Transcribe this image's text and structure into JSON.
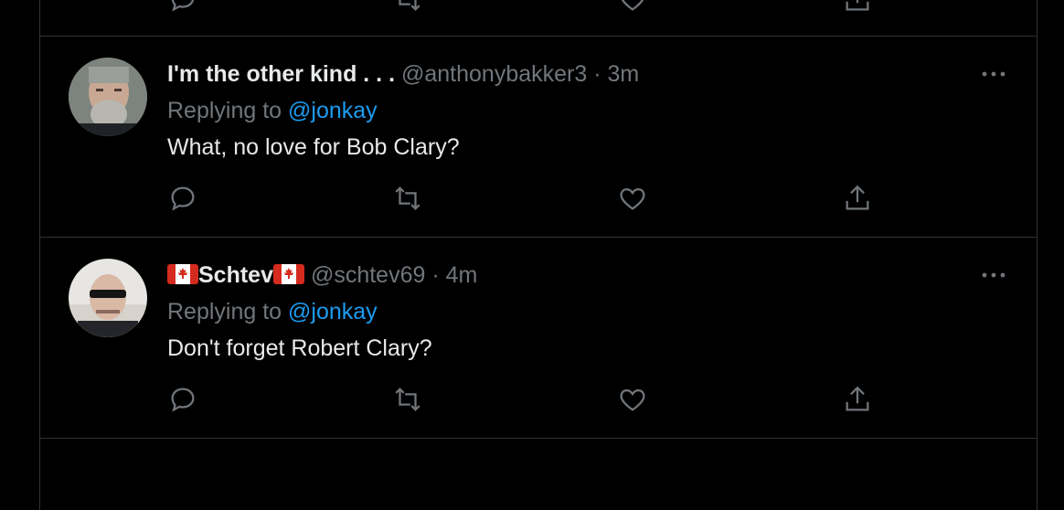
{
  "theme": {
    "background": "#000000",
    "border": "#2f3336",
    "text": "#e7e9ea",
    "muted": "#71767b",
    "link": "#1d9bf0"
  },
  "icons": {
    "reply": "reply-icon",
    "retweet": "retweet-icon",
    "like": "heart-icon",
    "share": "share-icon",
    "more": "more-icon",
    "flag": "canada-flag-icon"
  },
  "tweets": [
    {
      "display_name": "I'm the other kind . . .",
      "handle": "@anthonybakker3",
      "dot": "·",
      "time": "3m",
      "replying_prefix": "Replying to",
      "replying_to": "@jonkay",
      "text": "What, no love for Bob Clary?"
    },
    {
      "display_name": "Schtev",
      "handle": "@schtev69",
      "dot": "·",
      "time": "4m",
      "replying_prefix": "Replying to",
      "replying_to": "@jonkay",
      "text": "Don't forget Robert Clary?"
    }
  ]
}
